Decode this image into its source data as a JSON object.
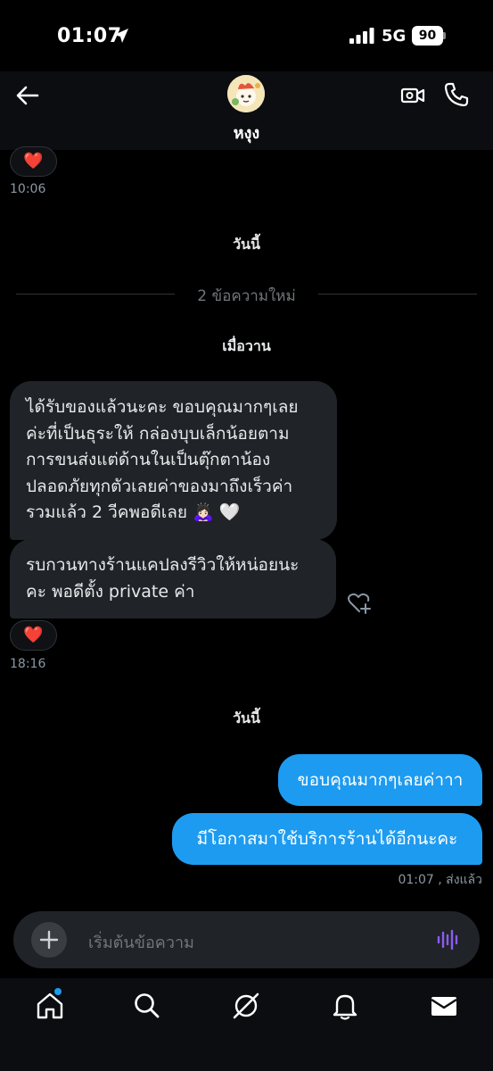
{
  "status_bar": {
    "time": "01:07",
    "network": "5G",
    "battery": "90"
  },
  "header": {
    "contact_name": "หงุง"
  },
  "thread": {
    "earlier_reaction": "❤️",
    "earlier_time": "10:06",
    "day_label_top": "วันนี้",
    "new_messages_divider": "2 ข้อความใหม่",
    "day_label_yesterday": "เมื่อวาน",
    "incoming": [
      {
        "lines": [
          "ได้รับของแล้วนะคะ ขอบคุณมากๆเลย",
          "ค่ะที่เป็นธุระให้ กล่องบุบเล็กน้อยตาม",
          "การขนส่งแต่ด้านในเป็นตุ๊กตาน้อง",
          "ปลอดภัยทุกตัวเลยค่าของมาถึงเร็วค่า",
          "รวมแล้ว 2 วีคพอดีเลย 🙇🏻‍♀️ 🤍"
        ]
      },
      {
        "lines": [
          "รบกวนทางร้านแคปลงรีวิวให้หน่อยนะ",
          "คะ พอดีตั้ง private ค่า"
        ]
      }
    ],
    "reaction": "❤️",
    "incoming_time": "18:16",
    "day_label_today": "วันนี้",
    "outgoing": [
      {
        "text": "ขอบคุณมากๆเลยค่าาา"
      },
      {
        "text": "มีโอกาสมาใช้บริการร้านได้อีกนะคะ"
      }
    ],
    "sent_status": "01:07 , ส่งแล้ว"
  },
  "composer": {
    "placeholder": "เริ่มต้นข้อความ"
  },
  "colors": {
    "accent": "#1d9bf0",
    "bubble_in": "#202327",
    "background": "#000000",
    "voice_icon": "#8b5cf6"
  },
  "icons": [
    "back-arrow-icon",
    "video-call-icon",
    "phone-call-icon",
    "add-reaction-icon",
    "plus-icon",
    "voice-waveform-icon",
    "home-icon",
    "search-icon",
    "grok-icon",
    "bell-icon",
    "mail-icon"
  ]
}
